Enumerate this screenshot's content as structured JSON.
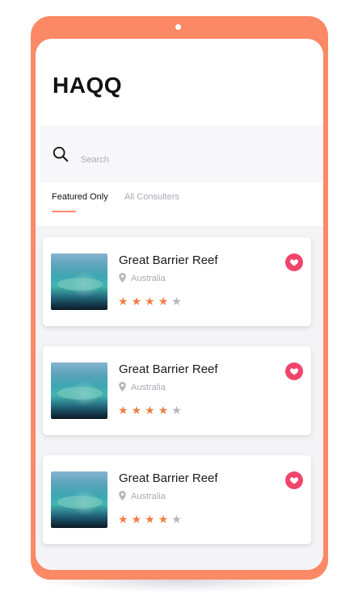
{
  "app": {
    "title": "HAQQ"
  },
  "search": {
    "placeholder": "Search",
    "icon": "search-icon"
  },
  "tabs": [
    {
      "label": "Featured Only",
      "active": true
    },
    {
      "label": "All Consulters",
      "active": false
    }
  ],
  "colors": {
    "accent": "#fb8965",
    "favorite": "#f1456b",
    "star_on": "#f07e44",
    "star_off": "#b5b5bd"
  },
  "places": [
    {
      "name": "Great Barrier Reef",
      "location": "Australia",
      "rating": 4,
      "max_rating": 5,
      "favorited": true
    },
    {
      "name": "Great Barrier Reef",
      "location": "Australia",
      "rating": 4,
      "max_rating": 5,
      "favorited": true
    },
    {
      "name": "Great Barrier Reef",
      "location": "Australia",
      "rating": 4,
      "max_rating": 5,
      "favorited": true
    }
  ]
}
